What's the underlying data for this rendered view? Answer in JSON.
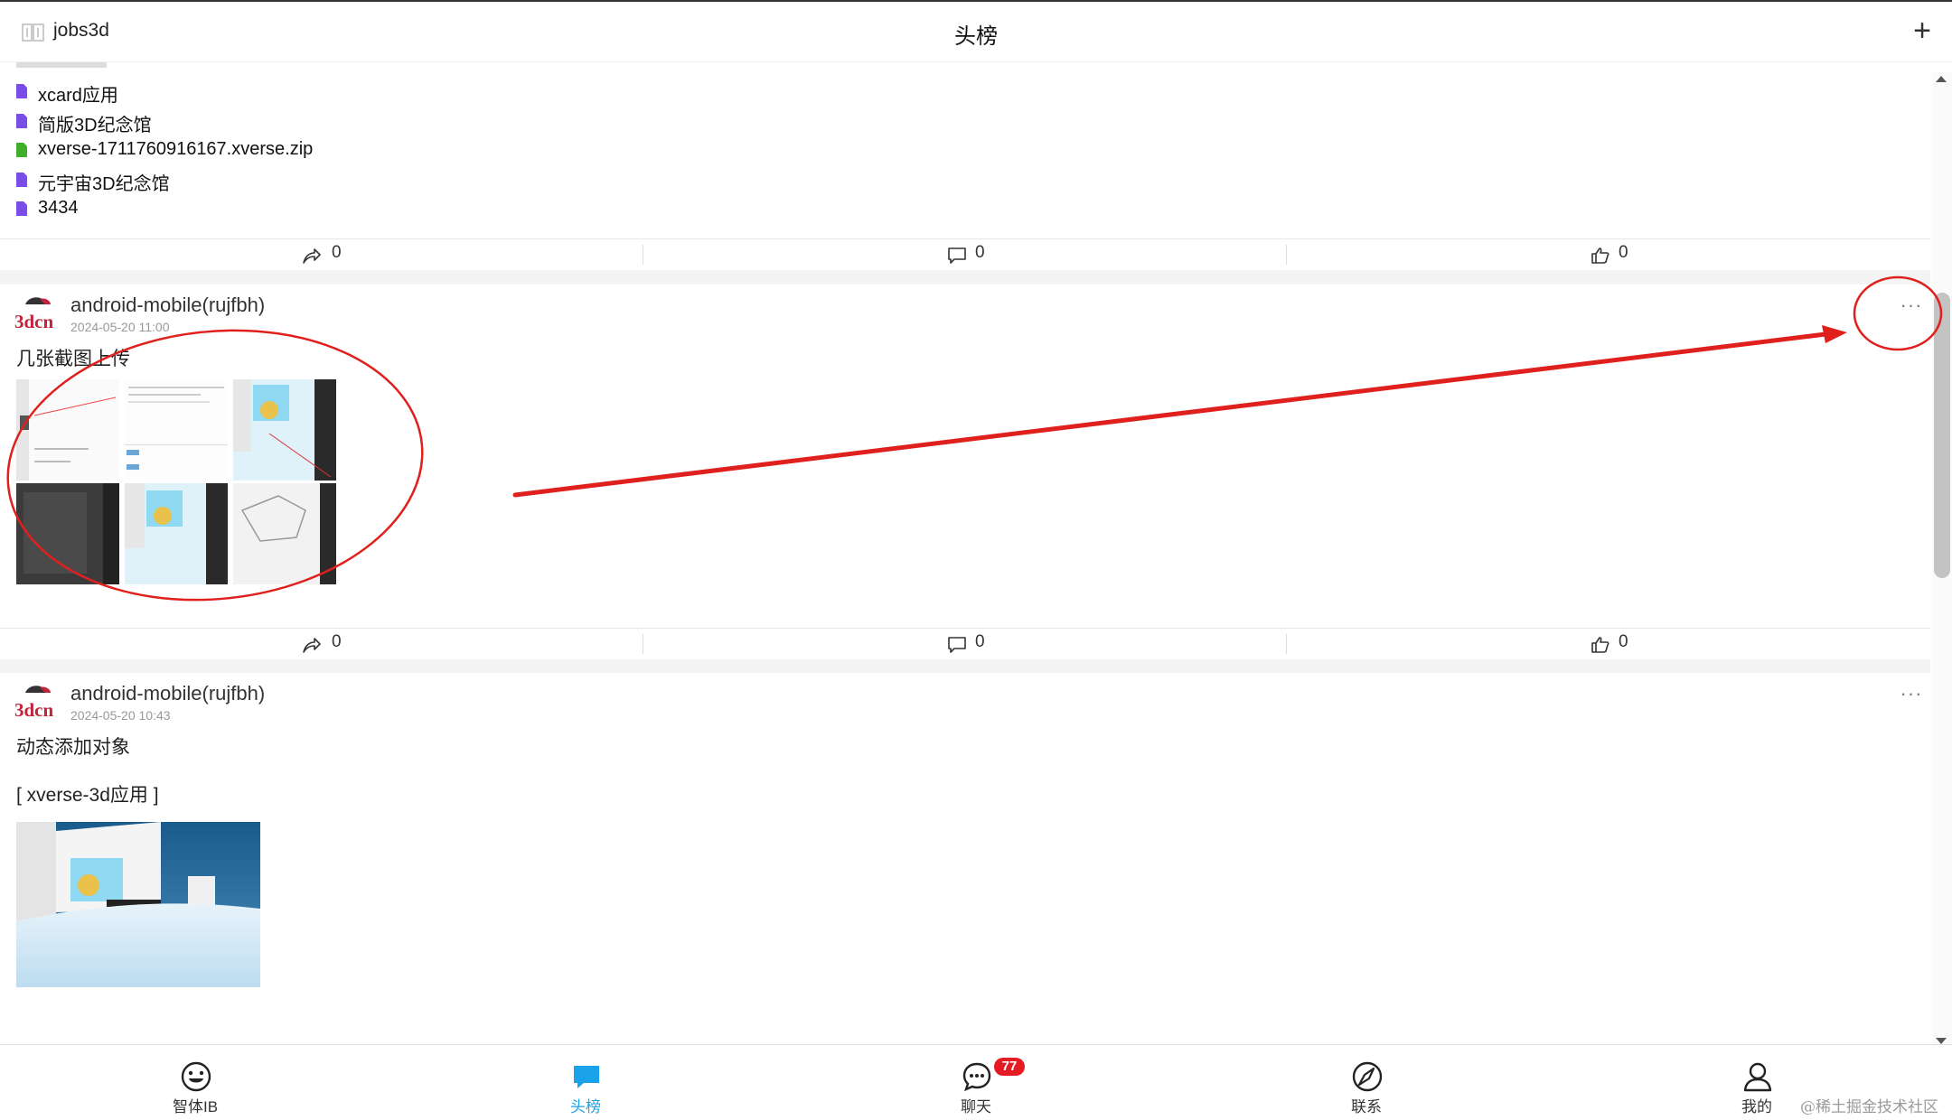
{
  "header": {
    "app_name": "jobs3d",
    "title": "头榜",
    "add_label": "+"
  },
  "file_list": [
    {
      "name": "xcard应用",
      "color": "#7a4ee6"
    },
    {
      "name": "简版3D纪念馆",
      "color": "#7a4ee6"
    },
    {
      "name": "xverse-1711760916167.xverse.zip",
      "color": "#3fae2a"
    },
    {
      "name": "元宇宙3D纪念馆",
      "color": "#7a4ee6"
    },
    {
      "name": "3434",
      "color": "#7a4ee6"
    }
  ],
  "posts": [
    {
      "actions": {
        "share": "0",
        "comment": "0",
        "like": "0"
      }
    },
    {
      "author": "android-mobile(rujfbh)",
      "time": "2024-05-20 11:00",
      "text": "几张截图上传",
      "avatar_text": "3dcn",
      "more": "···",
      "actions": {
        "share": "0",
        "comment": "0",
        "like": "0"
      }
    },
    {
      "author": "android-mobile(rujfbh)",
      "time": "2024-05-20 10:43",
      "text": "动态添加对象",
      "link": "[ xverse-3d应用 ]",
      "avatar_text": "3dcn",
      "more": "···"
    }
  ],
  "tabs": [
    {
      "label": "智体IB",
      "icon": "smiley-icon"
    },
    {
      "label": "头榜",
      "icon": "chat-bubble-icon",
      "active": true
    },
    {
      "label": "聊天",
      "icon": "chat-icon",
      "badge": "77"
    },
    {
      "label": "联系",
      "icon": "compass-icon"
    },
    {
      "label": "我的",
      "icon": "user-icon"
    }
  ],
  "watermark": "@稀土掘金技术社区",
  "colors": {
    "accent": "#1aa3e8",
    "annotation": "#e0201c",
    "badge": "#e41b23",
    "brand": "#c4223a"
  }
}
